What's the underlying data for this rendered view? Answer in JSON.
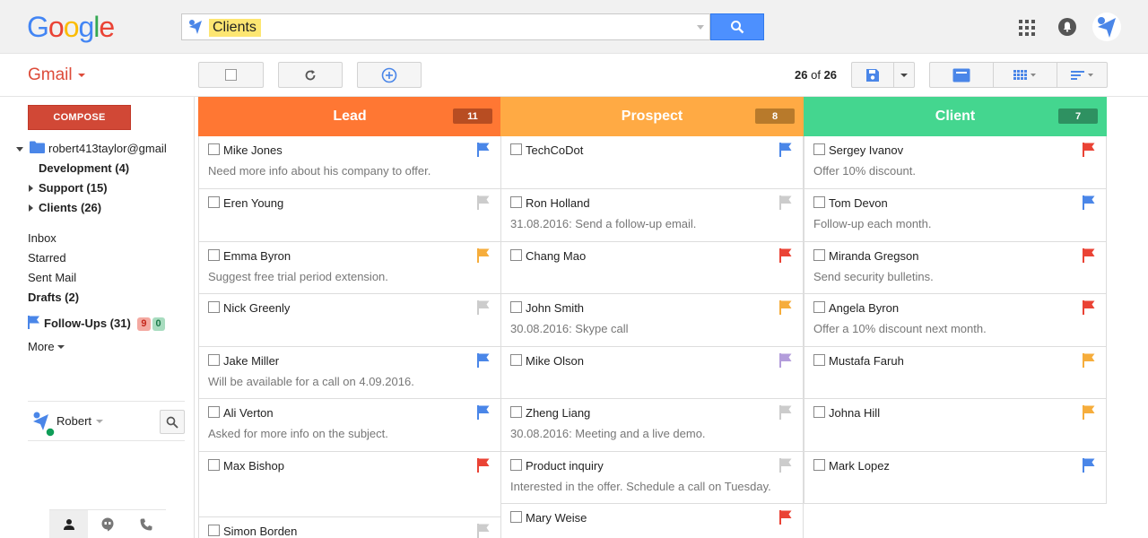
{
  "logo": {
    "letters": [
      "G",
      "o",
      "o",
      "g",
      "l",
      "e"
    ],
    "colors": [
      "#4285f4",
      "#ea4335",
      "#fbbc05",
      "#4285f4",
      "#34a853",
      "#ea4335"
    ]
  },
  "search": {
    "value": "Clients",
    "button_icon": "search-icon"
  },
  "header_icons": {
    "apps": "apps-icon",
    "notifications": "bell-icon",
    "account": "avatar"
  },
  "app_label": "Gmail",
  "toolbar": {
    "count_current": "26",
    "count_of": "of",
    "count_total": "26"
  },
  "sidebar": {
    "compose": "COMPOSE",
    "account": "robert413taylor@gmail",
    "folders": [
      {
        "label": "Development (4)"
      },
      {
        "label": "Support (15)"
      },
      {
        "label": "Clients (26)"
      }
    ],
    "mail_items": [
      {
        "label": "Inbox"
      },
      {
        "label": "Starred"
      },
      {
        "label": "Sent Mail"
      },
      {
        "label": "Drafts (2)"
      }
    ],
    "followups": {
      "label": "Follow-Ups (31)",
      "badge_red": "9",
      "badge_green": "0"
    },
    "more": "More",
    "user": "Robert"
  },
  "colors": {
    "lead": "#ff7733",
    "prospect": "#ffaa44",
    "client": "#44d68f",
    "lead_badge": "#b84d22",
    "prospect_badge": "#b87a2b",
    "client_badge": "#2e9161",
    "flag_blue": "#4a86e8",
    "flag_grey": "#cccccc",
    "flag_orange": "#f6ad3c",
    "flag_red": "#ea4335",
    "flag_purple": "#b39ddb"
  },
  "columns": [
    {
      "title": "Lead",
      "count": "11",
      "cards": [
        {
          "name": "Mike Jones",
          "note": "Need more info about his company to offer.",
          "flag": "blue"
        },
        {
          "name": "Eren Young",
          "note": "",
          "flag": "grey"
        },
        {
          "name": "Emma Byron",
          "note": "Suggest free trial period extension.",
          "flag": "orange"
        },
        {
          "name": "Nick Greenly",
          "note": "",
          "flag": "grey"
        },
        {
          "name": "Jake Miller",
          "note": "Will be available for a call on 4.09.2016.",
          "flag": "blue"
        },
        {
          "name": "Ali Verton",
          "note": "Asked for more info on the subject.",
          "flag": "blue"
        },
        {
          "name": "Max Bishop",
          "note": "",
          "flag": "red"
        },
        {
          "name": "Simon Borden",
          "note": "",
          "flag": "grey"
        }
      ]
    },
    {
      "title": "Prospect",
      "count": "8",
      "cards": [
        {
          "name": "TechCoDot",
          "note": "",
          "flag": "blue"
        },
        {
          "name": "Ron Holland",
          "note": "31.08.2016: Send a follow-up email.",
          "flag": "grey"
        },
        {
          "name": "Chang Mao",
          "note": "",
          "flag": "red"
        },
        {
          "name": "John Smith",
          "note": "30.08.2016: Skype call",
          "flag": "orange"
        },
        {
          "name": "Mike Olson",
          "note": "",
          "flag": "purple"
        },
        {
          "name": "Zheng Liang",
          "note": "30.08.2016: Meeting and a live demo.",
          "flag": "grey"
        },
        {
          "name": "Product inquiry",
          "note": "Interested in the offer. Schedule a call on Tuesday.",
          "flag": "grey"
        },
        {
          "name": "Mary Weise",
          "note": "",
          "flag": "red"
        }
      ]
    },
    {
      "title": "Client",
      "count": "7",
      "cards": [
        {
          "name": "Sergey Ivanov",
          "note": "Offer 10% discount.",
          "flag": "red"
        },
        {
          "name": "Tom Devon",
          "note": "Follow-up each month.",
          "flag": "blue"
        },
        {
          "name": "Miranda Gregson",
          "note": "Send security bulletins.",
          "flag": "red"
        },
        {
          "name": "Angela Byron",
          "note": "Offer a 10% discount next month.",
          "flag": "red"
        },
        {
          "name": "Mustafa Faruh",
          "note": "",
          "flag": "orange"
        },
        {
          "name": "Johna Hill",
          "note": "",
          "flag": "orange"
        },
        {
          "name": "Mark Lopez",
          "note": "",
          "flag": "blue"
        }
      ]
    }
  ]
}
